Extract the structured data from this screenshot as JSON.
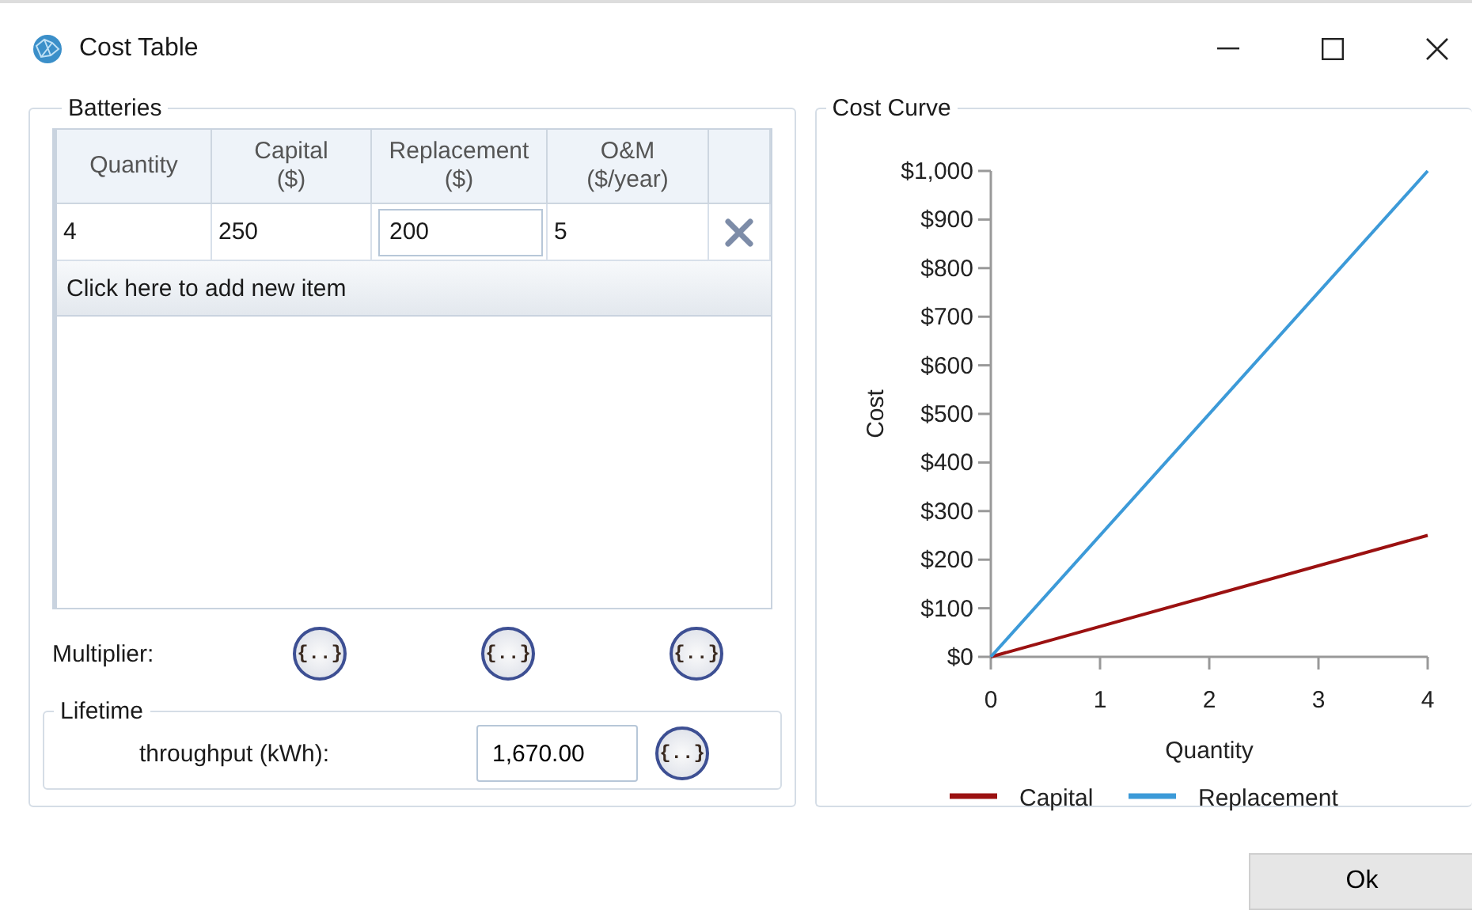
{
  "window": {
    "title": "Cost Table"
  },
  "batteries": {
    "title": "Batteries",
    "columns": [
      {
        "label": "Quantity"
      },
      {
        "label": "Capital",
        "unit": "($)"
      },
      {
        "label": "Replacement",
        "unit": "($)"
      },
      {
        "label": "O&M",
        "unit": "($/year)"
      }
    ],
    "rows": [
      {
        "cells": [
          {
            "value": "4",
            "editing": false
          },
          {
            "value": "250",
            "editing": false
          },
          {
            "value": "200",
            "editing": true
          },
          {
            "value": "5",
            "editing": false
          }
        ]
      }
    ],
    "add_row": "Click here to add new item",
    "multiplier": {
      "label": "Multiplier:",
      "buttons": [
        "{..}",
        "{..}",
        "{..}"
      ]
    },
    "lifetime": {
      "title": "Lifetime",
      "label": "throughput (kWh):",
      "value": "1,670.00",
      "button": "{..}"
    }
  },
  "cost_curve": {
    "title": "Cost Curve",
    "chart_data": {
      "type": "line",
      "xlabel": "Quantity",
      "ylabel": "Cost",
      "x": [
        0,
        4
      ],
      "legend": true,
      "xlim": [
        0,
        4
      ],
      "ylim": [
        0,
        1000
      ],
      "xticks": [
        0,
        1,
        2,
        3,
        4
      ],
      "yticks": [
        {
          "value": 0,
          "label": "$0"
        },
        {
          "value": 100,
          "label": "$100"
        },
        {
          "value": 200,
          "label": "$200"
        },
        {
          "value": 300,
          "label": "$300"
        },
        {
          "value": 400,
          "label": "$400"
        },
        {
          "value": 500,
          "label": "$500"
        },
        {
          "value": 600,
          "label": "$600"
        },
        {
          "value": 700,
          "label": "$700"
        },
        {
          "value": 800,
          "label": "$800"
        },
        {
          "value": 900,
          "label": "$900"
        },
        {
          "value": 1000,
          "label": "$1,000"
        }
      ],
      "series": [
        {
          "name": "Capital",
          "color": "#9b1111",
          "values": [
            0,
            250
          ]
        },
        {
          "name": "Replacement",
          "color": "#3c9ad8",
          "values": [
            0,
            1000
          ]
        }
      ]
    }
  },
  "buttons": [
    {
      "label": "Ok"
    }
  ]
}
